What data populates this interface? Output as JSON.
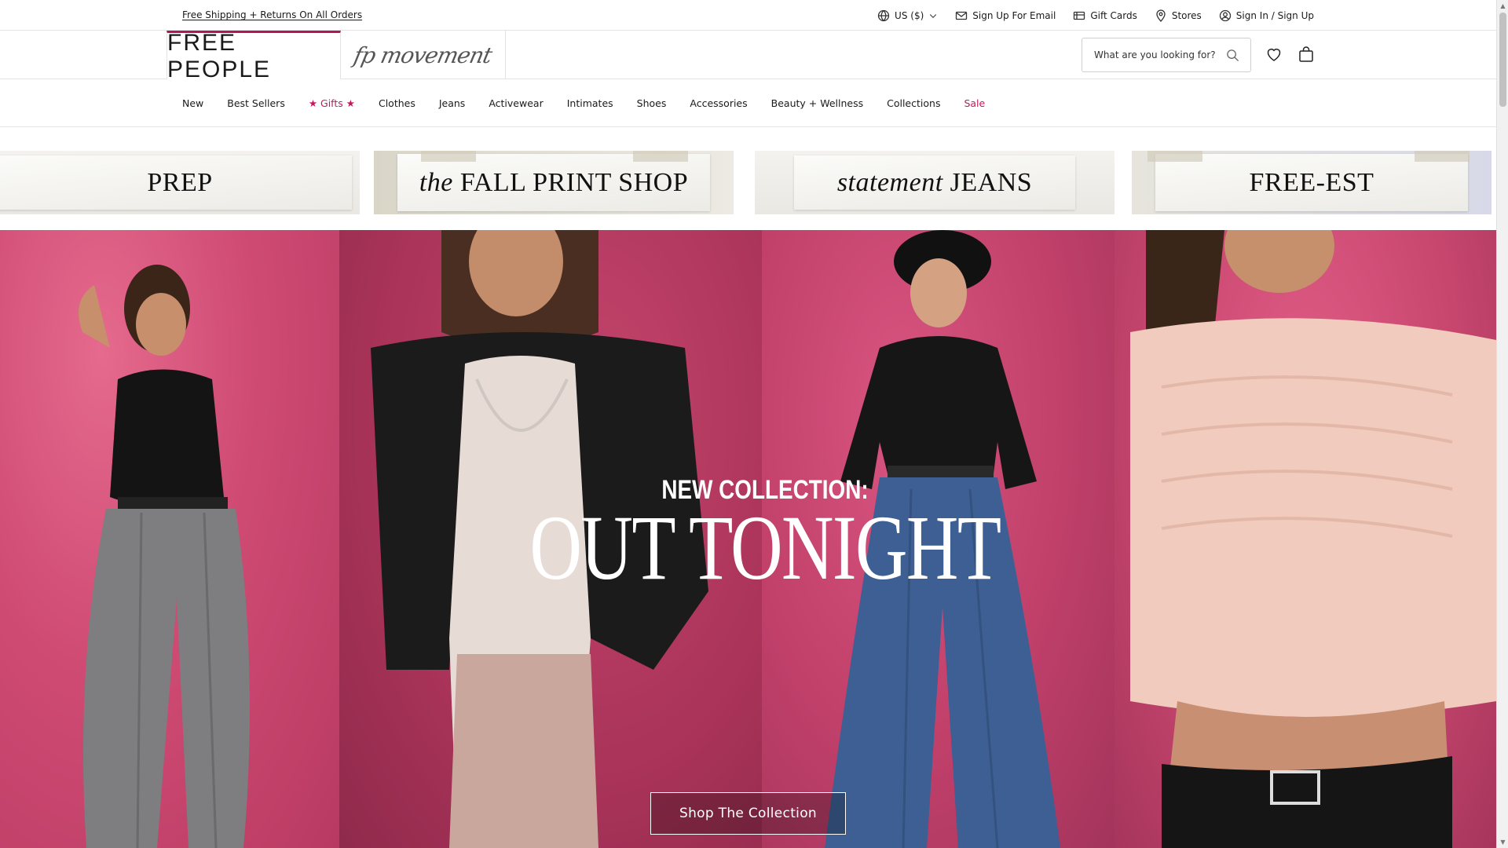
{
  "utility": {
    "promo": "Free Shipping + Returns On All Orders",
    "currency": "US ($)",
    "email_signup": "Sign Up For Email",
    "gift_cards": "Gift Cards",
    "stores": "Stores",
    "sign_in": "Sign In / Sign Up"
  },
  "header": {
    "brand": "FREE PEOPLE",
    "sub_brand": "fp movement",
    "search_placeholder": "What are you looking for?",
    "icons": [
      "globe-icon",
      "chevron-down-icon",
      "envelope-icon",
      "gift-card-icon",
      "map-pin-icon",
      "user-icon",
      "search-icon",
      "heart-icon",
      "bag-icon"
    ]
  },
  "nav": {
    "items": [
      {
        "label": "New"
      },
      {
        "label": "Best Sellers"
      },
      {
        "label": "★ Gifts ★"
      },
      {
        "label": "Clothes"
      },
      {
        "label": "Jeans"
      },
      {
        "label": "Activewear"
      },
      {
        "label": "Intimates"
      },
      {
        "label": "Shoes"
      },
      {
        "label": "Accessories"
      },
      {
        "label": "Beauty + Wellness"
      },
      {
        "label": "Collections"
      },
      {
        "label": "Sale"
      }
    ],
    "accent_color": "#c2185b"
  },
  "features": [
    {
      "label": "PREP"
    },
    {
      "label_italic": "the",
      "label": "FALL PRINT SHOP"
    },
    {
      "label_italic": "statement",
      "label": "JEANS"
    },
    {
      "label": "FREE-EST"
    }
  ],
  "hero": {
    "subtitle": "NEW COLLECTION:",
    "title": "OUT TONIGHT",
    "cta": "Shop The Collection",
    "background_color": "#c94a72"
  },
  "colors": {
    "brand_accent": "#b5145c",
    "text": "#1a1a1a",
    "border": "#e3e3e3"
  }
}
